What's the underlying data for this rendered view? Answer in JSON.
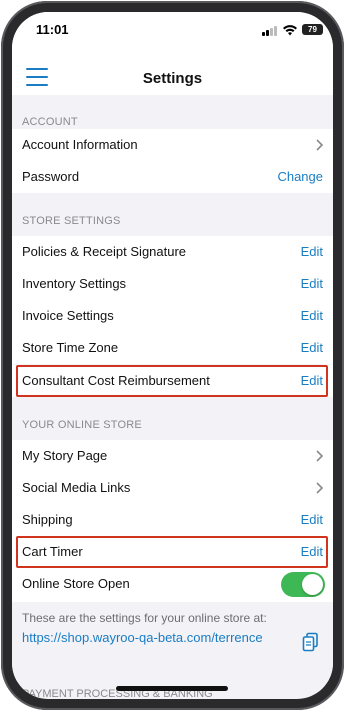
{
  "status_bar": {
    "time": "11:01",
    "battery": "79"
  },
  "nav": {
    "title": "Settings"
  },
  "sections": {
    "account": {
      "header": "ACCOUNT",
      "rows": [
        {
          "label": "Account Information",
          "action": ""
        },
        {
          "label": "Password",
          "action": "Change"
        }
      ]
    },
    "store_settings": {
      "header": "STORE SETTINGS",
      "rows": [
        {
          "label": "Policies & Receipt Signature",
          "action": "Edit"
        },
        {
          "label": "Inventory Settings",
          "action": "Edit"
        },
        {
          "label": "Invoice Settings",
          "action": "Edit"
        },
        {
          "label": "Store Time Zone",
          "action": "Edit"
        },
        {
          "label": "Consultant Cost Reimbursement",
          "action": "Edit"
        }
      ]
    },
    "online_store": {
      "header": "YOUR ONLINE STORE",
      "rows": [
        {
          "label": "My Story Page",
          "action": ""
        },
        {
          "label": "Social Media Links",
          "action": ""
        },
        {
          "label": "Shipping",
          "action": "Edit"
        },
        {
          "label": "Cart Timer",
          "action": "Edit"
        },
        {
          "label": "Online Store Open",
          "toggle": true
        }
      ],
      "info_text": "These are the settings for your online store at:",
      "url": "https://shop.wayroo-qa-beta.com/terrence"
    },
    "payment": {
      "header": "PAYMENT PROCESSING & BANKING"
    }
  },
  "colors": {
    "accent": "#1a7dc4",
    "highlight": "#d0341f",
    "toggle_on": "#3db854"
  }
}
